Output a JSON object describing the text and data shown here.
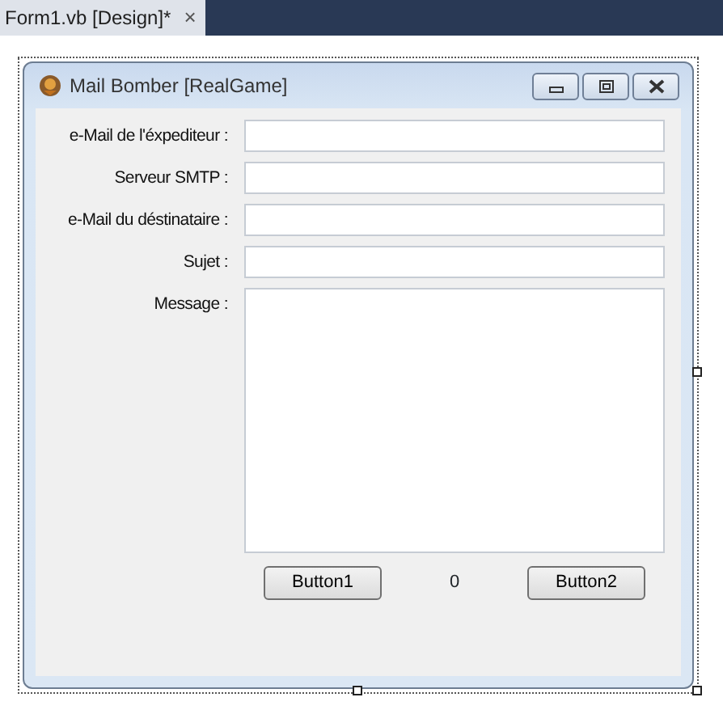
{
  "document_tab": {
    "title": "Form1.vb [Design]*",
    "close": "×",
    "selected": true
  },
  "form": {
    "title": "Mail Bomber [RealGame]",
    "fields": [
      {
        "label": "e-Mail de l'éxpediteur :",
        "kind": "text"
      },
      {
        "label": "Serveur SMTP :",
        "kind": "text"
      },
      {
        "label": "e-Mail du déstinataire :",
        "kind": "text"
      },
      {
        "label": "Sujet :",
        "kind": "text"
      },
      {
        "label": "Message :",
        "kind": "multiline"
      }
    ],
    "button_1": "Button1",
    "counter": "0",
    "button_2": "Button2"
  }
}
